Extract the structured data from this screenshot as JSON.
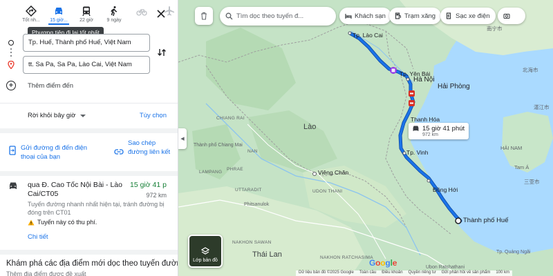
{
  "modes": [
    {
      "name": "best",
      "label": "Tốt nh..."
    },
    {
      "name": "car",
      "label": "15 giờ...",
      "active": true
    },
    {
      "name": "transit",
      "label": "22 giờ"
    },
    {
      "name": "walk",
      "label": "9 ngày"
    },
    {
      "name": "bike",
      "label": ""
    },
    {
      "name": "flight",
      "label": ""
    }
  ],
  "tooltip": "Phương tiện đi lại tốt nhất",
  "origin": "Tp. Huế, Thành phố Huế, Việt Nam",
  "destination": "tt. Sa Pa, Sa Pa, Lào Cai, Việt Nam",
  "add_destination": "Thêm điểm đến",
  "depart": "Rời khỏi bây giờ",
  "options": "Tùy chọn",
  "send_to_phone": "Gửi đường đi đến điện thoại của bạn",
  "copy_link": "Sao chép đường liên kết",
  "route": {
    "title": "qua Đ. Cao Tốc Nội Bài - Lào Cai/CT05",
    "time": "15 giờ 41 p",
    "distance": "972 km",
    "description": "Tuyến đường nhanh nhất hiện tại, tránh đường bị đóng trên CT01",
    "toll": "Tuyến này có thu phí.",
    "details": "Chi tiết"
  },
  "explore": {
    "title": "Khám phá các địa điểm mới dọc theo tuyến đường n",
    "subtitle": "Thêm địa điểm được đề xuất"
  },
  "map": {
    "search_placeholder": "Tìm dọc theo tuyến đ...",
    "chips": [
      "Khách sạn",
      "Trạm xăng",
      "Sạc xe điện"
    ],
    "callout_time": "15 giờ 41 phút",
    "callout_dist": "972 km",
    "layers_label": "Lớp bản đồ",
    "labels": {
      "lao_cai": "Tp. Lào Cai",
      "yen_bai": "Tp. Yên Bái",
      "ha_noi": "Hà Nội",
      "hai_phong": "Hải Phòng",
      "thanh_hoa": "Thanh Hóa",
      "vinh": "Tp. Vinh",
      "dong_hoi": "Đồng Hới",
      "hue": "Thành phố Huế",
      "lao": "Lào",
      "thai_lan": "Thái Lan",
      "vientiane": "Viêng Chăn",
      "udon_thani": "UDON THANI",
      "chiang_rai": "CHIANG RAI",
      "chiang_mai": "Thành phố Chiang Mai",
      "lampang": "LAMPANG",
      "phrae": "PHRAE",
      "nan": "NAN",
      "uttaradit": "UTTARADIT",
      "phitsanulok": "Phitsanulok",
      "nakhon_sawan": "NAKHON SAWAN",
      "nakhon_ratchasima": "NAKHON RATCHASIMA",
      "hai_nam": "HẢI NAM",
      "tam_a": "Tam Á",
      "nanning": "南宁市",
      "beihai": "北海市",
      "zhanjiang": "湛江市",
      "sanya": "三亚市",
      "quang_ngai": "Tp. Quảng Ngãi",
      "ubon": "Ubon Ratchathani"
    },
    "footer": [
      "Dữ liệu bản đồ ©2025 Google",
      "Toàn cầu",
      "Điều khoản",
      "Quyền riêng tư",
      "Gửi phản hồi về sản phẩm",
      "100 km"
    ]
  },
  "colors": {
    "route": "#1a73e8",
    "water": "#aadaff",
    "land": "#c8e6c9",
    "accent": "#1a73e8",
    "green_time": "#188038"
  }
}
